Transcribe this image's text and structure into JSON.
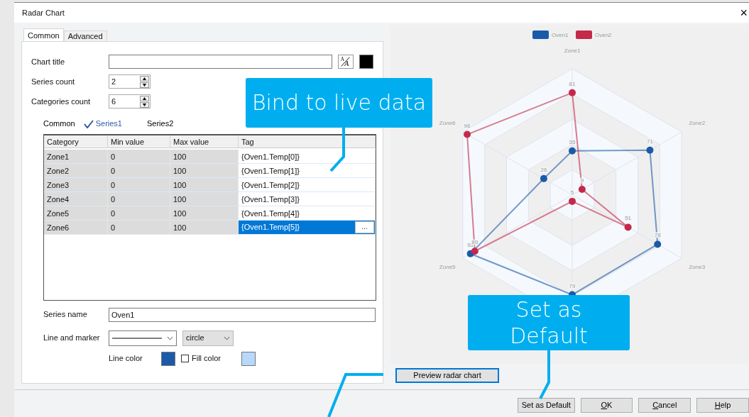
{
  "window": {
    "title": "Radar Chart",
    "close": "×"
  },
  "tabs": [
    {
      "label": "Common",
      "selected": true
    },
    {
      "label": "Advanced",
      "selected": false
    }
  ],
  "chart_title": {
    "label": "Chart title",
    "font_button": [
      "A",
      "A"
    ],
    "color": "#000000"
  },
  "series_count": {
    "label": "Series count",
    "value": "2"
  },
  "categories_count": {
    "label": "Categories count",
    "value": "6"
  },
  "series_tabs": [
    {
      "label": "Common",
      "selected": false
    },
    {
      "label": "Series1",
      "selected": true
    },
    {
      "label": "Series2",
      "selected": false
    }
  ],
  "grid": {
    "columns": [
      "Category",
      "Min value",
      "Max value",
      "Tag"
    ],
    "ellipsis_button": "...",
    "rows": [
      {
        "cells": [
          "Zone1",
          "0",
          "100",
          "{Oven1.Temp[0]}"
        ],
        "selected": false
      },
      {
        "cells": [
          "Zone2",
          "0",
          "100",
          "{Oven1.Temp[1]}"
        ],
        "selected": false
      },
      {
        "cells": [
          "Zone3",
          "0",
          "100",
          "{Oven1.Temp[2]}"
        ],
        "selected": false
      },
      {
        "cells": [
          "Zone4",
          "0",
          "100",
          "{Oven1.Temp[3]}"
        ],
        "selected": false
      },
      {
        "cells": [
          "Zone5",
          "0",
          "100",
          "{Oven1.Temp[4]}"
        ],
        "selected": false
      },
      {
        "cells": [
          "Zone6",
          "0",
          "100",
          "{Oven1.Temp[5]}"
        ],
        "selected": true
      }
    ]
  },
  "series_name": {
    "label": "Series name",
    "value": "Oven1"
  },
  "line_and_marker": {
    "label": "Line and marker",
    "marker": "circle"
  },
  "line_color": {
    "label": "Line color",
    "color": "#1a5aa8"
  },
  "fill_color": {
    "label": "Fill color",
    "checked": false,
    "color": "#b8d8fb"
  },
  "preview_button": "Preview radar chart",
  "radar": {
    "axis_labels": {
      "top": "Zone1",
      "upper_right": "Zone2",
      "lower_right": "Zone3",
      "lower_left": "Zone5",
      "upper_left": "Zone6"
    },
    "series": [
      {
        "name": "Oven1",
        "color": "#1a5aa8",
        "point_labels": [
          "35",
          "71",
          "78",
          "79",
          "93",
          "26"
        ]
      },
      {
        "name": "Oven2",
        "color": "#c4284a",
        "point_labels": [
          "81",
          "9",
          "51",
          "5",
          "89",
          "96"
        ]
      }
    ]
  },
  "buttons": [
    {
      "label": "Set as Default"
    },
    {
      "access_key": "O",
      "rest": "K"
    },
    {
      "access_key": "C",
      "rest": "ancel"
    },
    {
      "access_key": "H",
      "rest": "elp"
    }
  ],
  "callouts": [
    {
      "text": "Bind to live data"
    },
    {
      "text": "Set as Default"
    }
  ]
}
